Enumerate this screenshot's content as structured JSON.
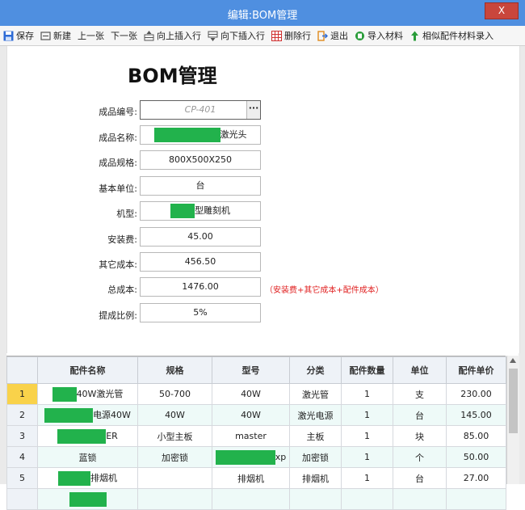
{
  "window": {
    "title": "编辑:BOM管理",
    "close_label": "X"
  },
  "toolbar": [
    {
      "name": "save-button",
      "icon": "save-icon",
      "label": "保存",
      "color": "#2d6bd6"
    },
    {
      "name": "new-button",
      "icon": "new-icon",
      "label": "新建",
      "color": "#555555"
    },
    {
      "name": "prev-button",
      "icon": "",
      "label": "上一张",
      "color": ""
    },
    {
      "name": "next-button",
      "icon": "",
      "label": "下一张",
      "color": ""
    },
    {
      "name": "insert-up-button",
      "icon": "insert-up-icon",
      "label": "向上插入行",
      "color": "#555555"
    },
    {
      "name": "insert-down-button",
      "icon": "insert-down-icon",
      "label": "向下插入行",
      "color": "#555555"
    },
    {
      "name": "delete-row-button",
      "icon": "delete-row-icon",
      "label": "删除行",
      "color": "#d03030"
    },
    {
      "name": "exit-button",
      "icon": "exit-icon",
      "label": "退出",
      "color": "#e08a1c"
    },
    {
      "name": "import-button",
      "icon": "import-icon",
      "label": "导入材料",
      "color": "#2a9d3a"
    },
    {
      "name": "similar-import-button",
      "icon": "arrow-up-icon",
      "label": "相似配件材料录入",
      "color": "#2a9d3a"
    }
  ],
  "form": {
    "title": "BOM管理",
    "fields": [
      {
        "label": "成品编号:",
        "value": "",
        "placeholder": "CP-401"
      },
      {
        "label": "成品名称:",
        "value": "激光头"
      },
      {
        "label": "成品规格:",
        "value": "800X500X250"
      },
      {
        "label": "基本单位:",
        "value": "台"
      },
      {
        "label": "机型:",
        "value": "型雕刻机"
      },
      {
        "label": "安装费:",
        "value": "45.00"
      },
      {
        "label": "其它成本:",
        "value": "456.50"
      },
      {
        "label": "总成本:",
        "value": "1476.00"
      },
      {
        "label": "提成比例:",
        "value": "5%"
      }
    ],
    "total_hint": "（安装费+其它成本+配件成本）"
  },
  "grid": {
    "columns": [
      "",
      "配件名称",
      "规格",
      "型号",
      "分类",
      "配件数量",
      "单位",
      "配件单价"
    ],
    "rows": [
      {
        "num": "1",
        "name": "40W激光管",
        "spec": "50-700",
        "model": "40W",
        "category": "激光管",
        "qty": "1",
        "unit": "支",
        "price": "230.00"
      },
      {
        "num": "2",
        "name": "电源40W",
        "spec": "40W",
        "model": "40W",
        "category": "激光电源",
        "qty": "1",
        "unit": "台",
        "price": "145.00"
      },
      {
        "num": "3",
        "name": "ER",
        "spec": "小型主板",
        "model": "master",
        "category": "主板",
        "qty": "1",
        "unit": "块",
        "price": "85.00"
      },
      {
        "num": "4",
        "name": "蓝锁",
        "spec": "加密锁",
        "model": "xp",
        "category": "加密锁",
        "qty": "1",
        "unit": "个",
        "price": "50.00"
      },
      {
        "num": "5",
        "name": "排烟机",
        "spec": "",
        "model": "排烟机",
        "category": "排烟机",
        "qty": "1",
        "unit": "台",
        "price": "27.00"
      }
    ]
  },
  "colors": {
    "titlebar": "#4f8fe0",
    "redaction": "#22b24c",
    "selected_row": "#f9d24a",
    "hint": "#e02020"
  }
}
